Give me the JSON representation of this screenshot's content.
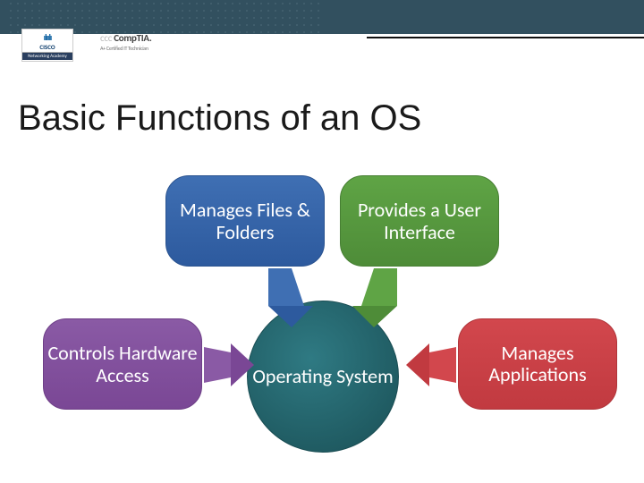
{
  "header": {
    "cisco_logo_text": "CISCO",
    "cisco_logo_sub": "Networking Academy",
    "comptia_logo_text": "CompTIA",
    "comptia_logo_sub": "A+ Certified  IT Technician"
  },
  "title": "Basic Functions of an OS",
  "diagram": {
    "center": "Operating System",
    "files": "Manages Files & Folders",
    "ui": "Provides a User Interface",
    "hw": "Controls Hardware Access",
    "apps": "Manages Applications"
  },
  "colors": {
    "files": "#2d5a9e",
    "ui": "#4e8c38",
    "hw": "#7a4795",
    "apps": "#c13a40",
    "center": "#1f5a61"
  }
}
